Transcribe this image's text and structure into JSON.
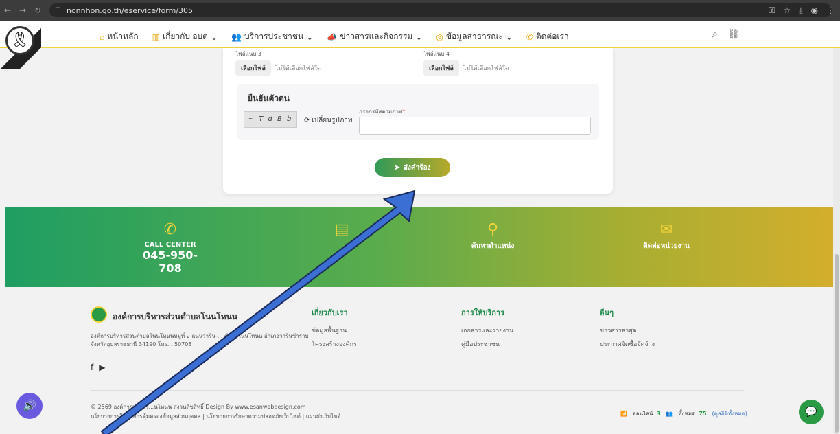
{
  "browser": {
    "url": "nonnhon.go.th/eservice/form/305"
  },
  "nav": {
    "items": [
      {
        "label": "หน้าหลัก",
        "icon": "home-icon"
      },
      {
        "label": "เกี่ยวกับ อบต",
        "icon": "building-icon",
        "dropdown": true
      },
      {
        "label": "บริการประชาชน",
        "icon": "people-icon",
        "dropdown": true
      },
      {
        "label": "ข่าวสารและกิจกรรม",
        "icon": "megaphone-icon",
        "dropdown": true
      },
      {
        "label": "ข้อมูลสาธารณะ",
        "icon": "database-icon",
        "dropdown": true
      },
      {
        "label": "ติดต่อเรา",
        "icon": "phone-icon"
      }
    ]
  },
  "form": {
    "file3_label": "ไฟล์แนบ 3",
    "file4_label": "ไฟล์แนบ 4",
    "file_button": "เลือกไฟล์",
    "file_none": "ไม่ได้เลือกไฟล์ใด",
    "verify_title": "ยืนยันตัวตน",
    "captcha_text": "~ T d B b",
    "refresh_label": "เปลี่ยนรูปภาพ",
    "captcha_label": "กรอกรหัสตามภาพ",
    "captcha_value": "",
    "submit_label": "ส่งคำร้อง"
  },
  "band": {
    "call_center_label": "CALL CENTER",
    "call_center_number": "045-950-708",
    "col2": "",
    "col3": "ค้นหาตำแหน่ง",
    "col4": "ติดต่อหน่วยงาน"
  },
  "footer": {
    "org_name": "องค์การบริหารส่วนตำบลโนนโหนน",
    "org_address": "องค์การบริหารส่วนตำบลโนนโหนนหมู่ที่ 2 ถนนวาริน-... ตำบลโนนโหนน อำเภอวารินชำราบ จังหวัดอุบลราชธานี 34190 โทร... 50708",
    "col_about": {
      "title": "เกี่ยวกับเรา",
      "links": [
        "ข้อมูลพื้นฐาน",
        "โครงสร้างองค์กร"
      ]
    },
    "col_services": {
      "title": "การให้บริการ",
      "links": [
        "เอกสารและรายงาน",
        "คู่มือประชาชน"
      ]
    },
    "col_other": {
      "title": "อื่นๆ",
      "links": [
        "ข่าวสารล่าสุด",
        "ประกาศจัดซื้อจัดจ้าง"
      ]
    },
    "copyright": "© 2569 องค์การบริหาร...นโหนน สงวนลิขสิทธิ์ Design By www.esanwebdesign.com",
    "policies": "นโยบายการใช้... การคุ้มครองข้อมูลส่วนบุคคล | นโยบายการรักษาความปลอดภัยเว็บไซต์ | แผนผังเว็บไซต์",
    "online_label": "ออนไลน์:",
    "online_count": "3",
    "total_label": "ทั้งหมด:",
    "total_count": "75",
    "view_all": "(ดูสถิติทั้งหมด)"
  },
  "colors": {
    "accent_yellow": "#f1d23a",
    "green": "#1f9e62",
    "arrow": "#3b6fd4"
  }
}
